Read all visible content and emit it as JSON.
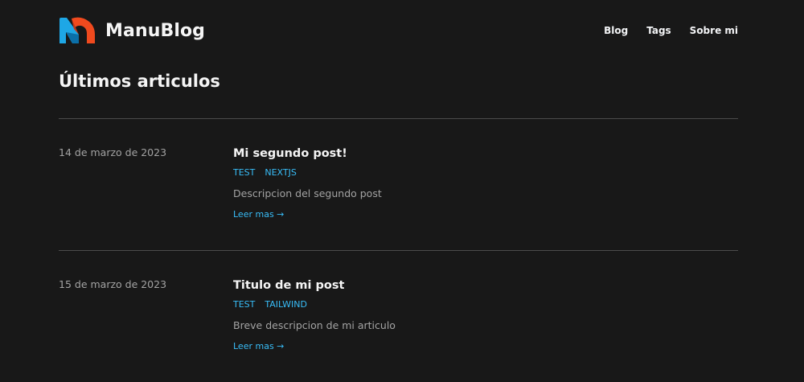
{
  "header": {
    "brand_name": "ManuBlog",
    "logo_icon": "manublog-logo-icon",
    "nav": [
      {
        "label": "Blog"
      },
      {
        "label": "Tags"
      },
      {
        "label": "Sobre mi"
      }
    ]
  },
  "main": {
    "heading": "Últimos articulos",
    "posts": [
      {
        "date": "14 de marzo de 2023",
        "title": "Mi segundo post!",
        "tags": [
          "TEST",
          "NEXTJS"
        ],
        "description": "Descripcion del segundo post",
        "read_more": "Leer mas →"
      },
      {
        "date": "15 de marzo de 2023",
        "title": "Titulo de mi post",
        "tags": [
          "TEST",
          "TAILWIND"
        ],
        "description": "Breve descripcion de mi articulo",
        "read_more": "Leer mas →"
      }
    ]
  },
  "colors": {
    "background": "#181818",
    "accent": "#38bdf8",
    "muted_text": "#a3a3a3",
    "divider": "#4b4b4b",
    "logo_blue": "#1ea7e6",
    "logo_red": "#f04a1e"
  }
}
